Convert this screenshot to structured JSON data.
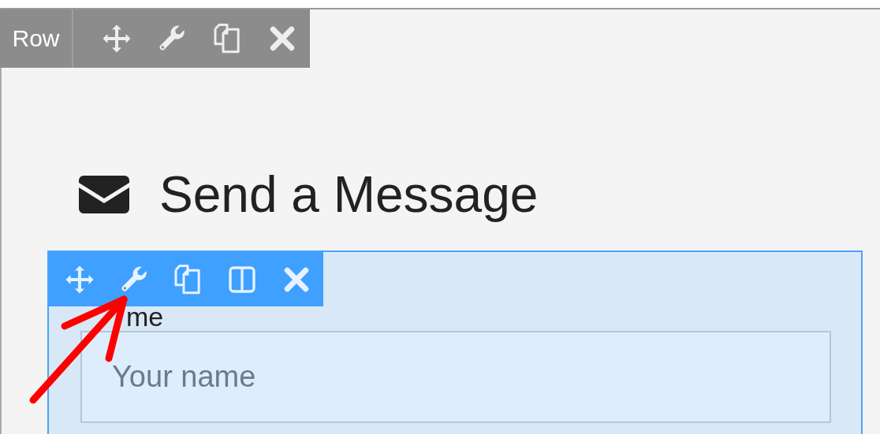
{
  "row_toolbar": {
    "label": "Row",
    "tools": [
      {
        "kind": "move"
      },
      {
        "kind": "settings"
      },
      {
        "kind": "duplicate"
      },
      {
        "kind": "delete"
      }
    ]
  },
  "heading": {
    "text": "Send a Message"
  },
  "field_block": {
    "toolbar": {
      "tools": [
        {
          "kind": "move"
        },
        {
          "kind": "settings"
        },
        {
          "kind": "duplicate"
        },
        {
          "kind": "columns"
        },
        {
          "kind": "delete"
        }
      ]
    },
    "label": "me",
    "input": {
      "placeholder": "Your name"
    }
  }
}
